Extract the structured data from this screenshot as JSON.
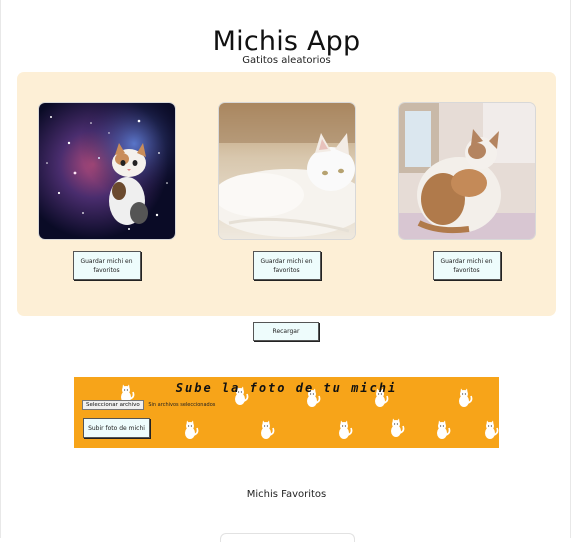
{
  "header": {
    "title": "Michis App"
  },
  "random_section": {
    "heading": "Gatitos aleatorios",
    "cards": [
      {
        "image": "cat-in-galaxy-photo",
        "button_label": "Guardar michi en favoritos"
      },
      {
        "image": "white-cat-lying-photo",
        "button_label": "Guardar michi en favoritos"
      },
      {
        "image": "calico-cat-window-photo",
        "button_label": "Guardar michi en favoritos"
      }
    ],
    "reload_label": "Recargar"
  },
  "upload_section": {
    "title": "Sube la foto de tu michi",
    "file_button_label": "Seleccionar archivo",
    "file_status": "Sin archivos seleccionados",
    "submit_label": "Subir foto de michi",
    "background_pattern": "white-cat-pattern-icon"
  },
  "favorites_section": {
    "heading": "Michis Favoritos"
  },
  "colors": {
    "panel_bg": "#fdefd6",
    "button_bg": "#eefcfc",
    "upload_bg": "#f7a419"
  }
}
